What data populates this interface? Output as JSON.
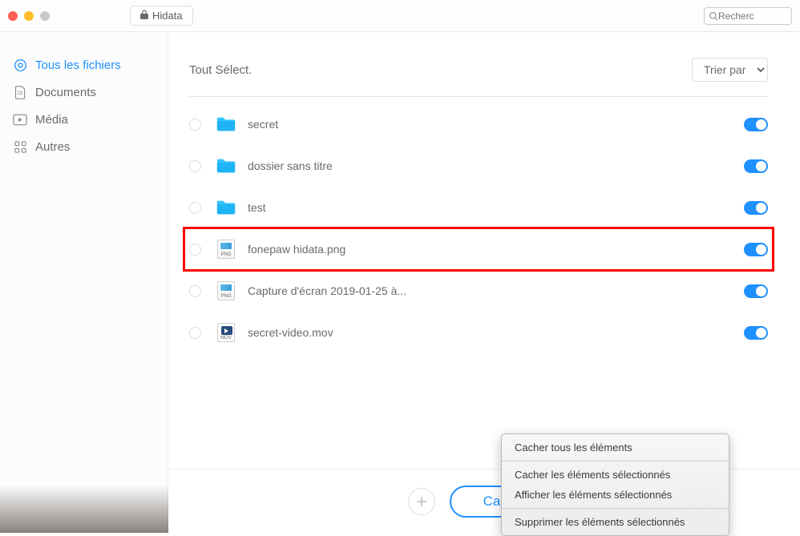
{
  "titlebar": {
    "app_name": "Hidata",
    "search_placeholder": "Recherc"
  },
  "sidebar": {
    "items": [
      {
        "label": "Tous les fichiers",
        "icon": "target",
        "active": true
      },
      {
        "label": "Documents",
        "icon": "doc",
        "active": false
      },
      {
        "label": "Média",
        "icon": "media",
        "active": false
      },
      {
        "label": "Autres",
        "icon": "grid",
        "active": false
      }
    ]
  },
  "main": {
    "select_all_label": "Tout Sélect.",
    "sort_label": "Trier par",
    "files": [
      {
        "name": "secret",
        "type": "folder",
        "toggled": true,
        "highlighted": false
      },
      {
        "name": "dossier sans titre",
        "type": "folder",
        "toggled": true,
        "highlighted": false
      },
      {
        "name": "test",
        "type": "folder",
        "toggled": true,
        "highlighted": false
      },
      {
        "name": "fonepaw hidata.png",
        "type": "png",
        "toggled": true,
        "highlighted": true
      },
      {
        "name": "Capture d'écran 2019-01-25 à...",
        "type": "png",
        "toggled": true,
        "highlighted": false
      },
      {
        "name": "secret-video.mov",
        "type": "mov",
        "toggled": true,
        "highlighted": false
      }
    ]
  },
  "bottom": {
    "hide_label": "Cacher"
  },
  "context_menu": {
    "items": [
      "Cacher tous les éléments",
      "Cacher les éléments sélectionnés",
      "Afficher les éléments sélectionnés",
      "Supprimer les éléments sélectionnés"
    ]
  },
  "file_badges": {
    "png": "PNG",
    "mov": "MOV"
  }
}
